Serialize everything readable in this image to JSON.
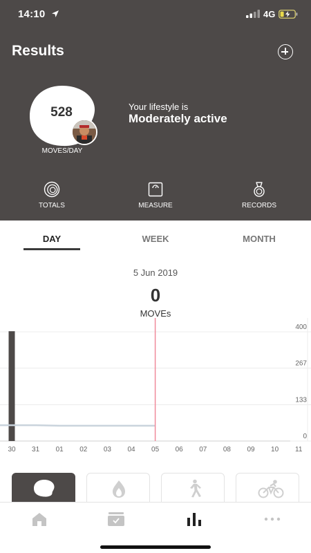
{
  "status_bar": {
    "time": "14:10",
    "network": "4G"
  },
  "header": {
    "title": "Results",
    "add_icon": "plus-circle-icon"
  },
  "summary": {
    "moves_per_day": "528",
    "moves_caption": "MOVES/DAY",
    "lifestyle_prefix": "Your lifestyle is",
    "lifestyle_level": "Moderately active"
  },
  "hero_actions": [
    {
      "label": "TOTALS",
      "icon": "spiral-icon"
    },
    {
      "label": "MEASURE",
      "icon": "scale-icon"
    },
    {
      "label": "RECORDS",
      "icon": "medal-icon"
    }
  ],
  "tabs": [
    {
      "label": "DAY",
      "active": true
    },
    {
      "label": "WEEK",
      "active": false
    },
    {
      "label": "MONTH",
      "active": false
    }
  ],
  "selected": {
    "date": "5 Jun 2019",
    "value": "0",
    "unit": "MOVEs"
  },
  "chart_data": {
    "type": "bar",
    "categories": [
      "30",
      "31",
      "01",
      "02",
      "03",
      "04",
      "05",
      "06",
      "07",
      "08",
      "09",
      "10",
      "11"
    ],
    "values": [
      402,
      0,
      0,
      0,
      0,
      0,
      0,
      null,
      null,
      null,
      null,
      null,
      null
    ],
    "average_line": [
      58,
      58,
      56,
      56,
      56,
      56,
      56
    ],
    "selected_category": "05",
    "y_ticks": [
      0,
      133,
      267,
      400
    ],
    "ylim": [
      0,
      410
    ],
    "colors": {
      "bar": "#4d4948",
      "average": "#c9d3dc",
      "selected": "#f08a9a",
      "grid": "#ececec"
    }
  },
  "activity_cards": [
    {
      "icon": "moves-blob-icon",
      "active": true
    },
    {
      "icon": "flame-icon",
      "active": false
    },
    {
      "icon": "walking-icon",
      "active": false
    },
    {
      "icon": "cycling-icon",
      "active": false
    }
  ],
  "bottom_nav": [
    {
      "icon": "home-icon",
      "active": false
    },
    {
      "icon": "inbox-icon",
      "active": false
    },
    {
      "icon": "bar-chart-icon",
      "active": true
    },
    {
      "icon": "more-icon",
      "active": false
    }
  ]
}
